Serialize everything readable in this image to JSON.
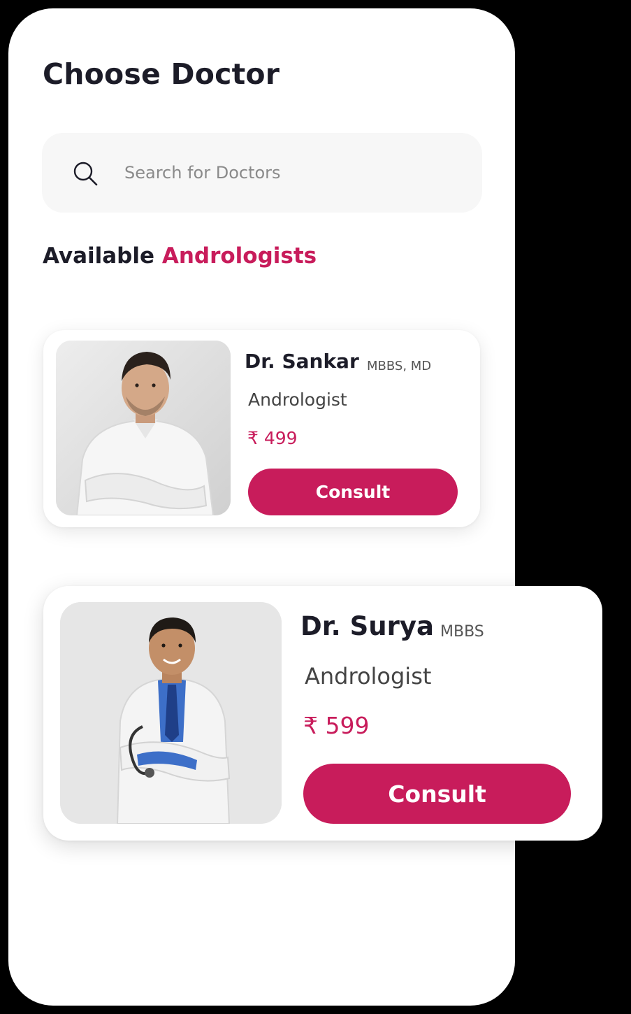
{
  "page": {
    "title": "Choose Doctor"
  },
  "search": {
    "placeholder": "Search for Doctors",
    "icon": "search-icon"
  },
  "section": {
    "prefix": "Available",
    "highlight": "Andrologists"
  },
  "doctors": [
    {
      "name": "Dr. Sankar",
      "degree": "MBBS, MD",
      "specialty": "Andrologist",
      "price": "₹ 499",
      "button_label": "Consult"
    },
    {
      "name": "Dr. Surya",
      "degree": "MBBS",
      "specialty": "Andrologist",
      "price": "₹ 599",
      "button_label": "Consult"
    }
  ],
  "colors": {
    "accent": "#c81c5b",
    "text": "#1c1c28",
    "search_bg": "#f7f7f7"
  }
}
